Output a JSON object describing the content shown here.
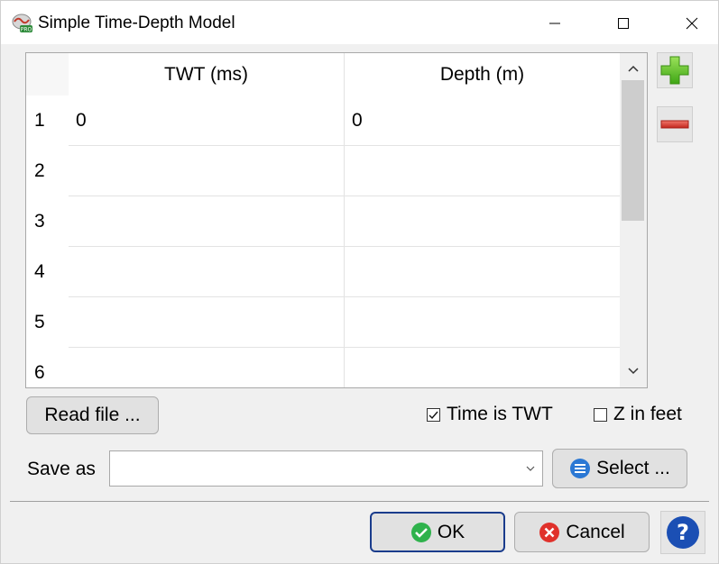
{
  "window": {
    "title": "Simple Time-Depth Model",
    "controls": [
      "minimize",
      "maximize",
      "close"
    ]
  },
  "table": {
    "columns": [
      "TWT (ms)",
      "Depth (m)"
    ],
    "rows": [
      {
        "index": "1",
        "twt": "0",
        "depth": "0"
      },
      {
        "index": "2",
        "twt": "",
        "depth": ""
      },
      {
        "index": "3",
        "twt": "",
        "depth": ""
      },
      {
        "index": "4",
        "twt": "",
        "depth": ""
      },
      {
        "index": "5",
        "twt": "",
        "depth": ""
      },
      {
        "index": "6",
        "twt": "",
        "depth": ""
      }
    ]
  },
  "side_buttons": {
    "add_icon": "plus-icon",
    "remove_icon": "minus-icon"
  },
  "actions": {
    "read_file": "Read file ...",
    "time_is_twt": "Time is TWT",
    "time_is_twt_checked": true,
    "z_in_feet": "Z in feet",
    "z_in_feet_checked": false
  },
  "save": {
    "label": "Save as",
    "value": "",
    "select_label": "Select ..."
  },
  "footer": {
    "ok_label": "OK",
    "cancel_label": "Cancel",
    "help_icon": "help-icon"
  },
  "colors": {
    "ok_border": "#1a3c8c",
    "add_green": "#5cc61e",
    "remove_red": "#d9342b",
    "help_blue": "#1b4fb4"
  }
}
